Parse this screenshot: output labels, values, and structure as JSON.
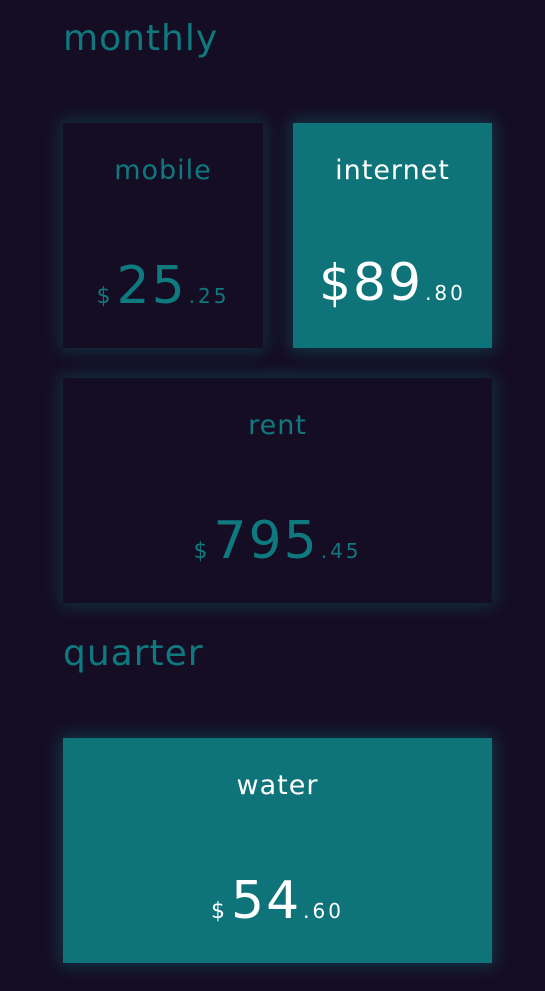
{
  "sections": {
    "monthly": {
      "title": "monthly",
      "items": [
        {
          "label": "mobile",
          "currency": "$",
          "whole": "25",
          "fraction": ".25"
        },
        {
          "label": "internet",
          "currency": "$",
          "whole": "89",
          "fraction": ".80"
        },
        {
          "label": "rent",
          "currency": "$",
          "whole": "795",
          "fraction": ".45"
        }
      ]
    },
    "quarter": {
      "title": "quarter",
      "items": [
        {
          "label": "water",
          "currency": "$",
          "whole": "54",
          "fraction": ".60"
        }
      ]
    }
  },
  "colors": {
    "background": "#150d24",
    "accent": "#0e7a7f",
    "active_card": "#0e7479",
    "active_text": "#ffffff"
  }
}
